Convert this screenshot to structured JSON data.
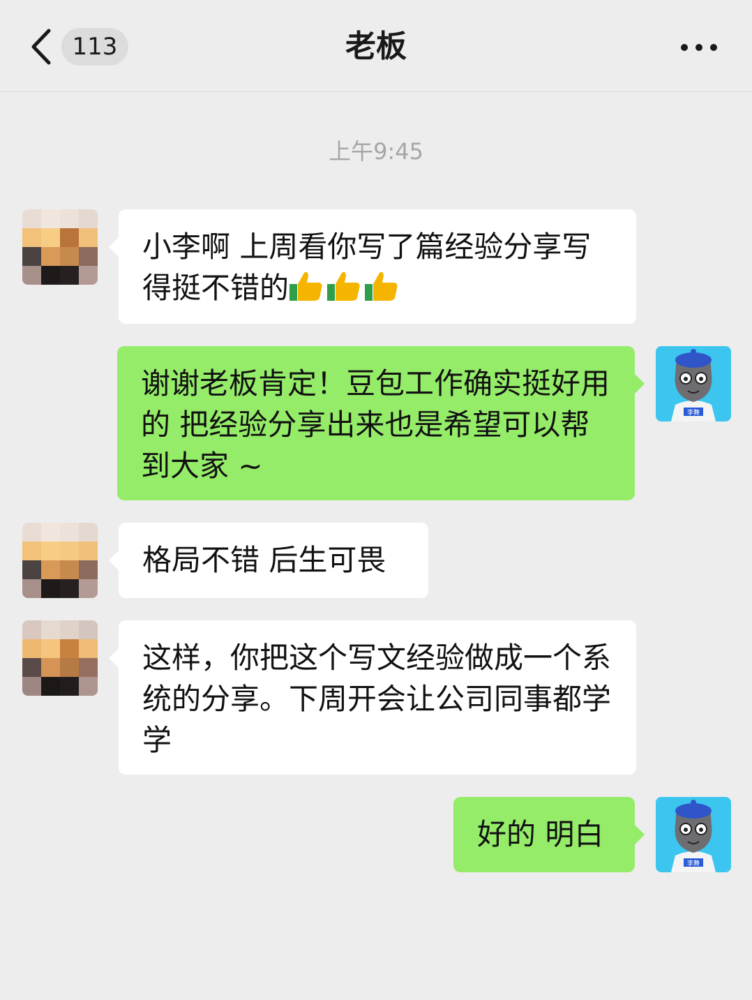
{
  "header": {
    "unread_count": "113",
    "title": "老板"
  },
  "chat": {
    "timestamp": "上午9:45",
    "messages": [
      {
        "sender": "boss",
        "text": "小李啊 上周看你写了篇经验分享写得挺不错的",
        "emoji": [
          "thumbs-up",
          "thumbs-up",
          "thumbs-up"
        ]
      },
      {
        "sender": "me",
        "text": "谢谢老板肯定！豆包工作确实挺好用的 把经验分享出来也是希望可以帮到大家 ~"
      },
      {
        "sender": "boss",
        "text": "格局不错 后生可畏"
      },
      {
        "sender": "boss",
        "text": "这样，你把这个写文经验做成一个系统的分享。下周开会让公司同事都学学"
      },
      {
        "sender": "me",
        "text": "好的 明白"
      }
    ]
  },
  "avatar_badge_text": "李舞",
  "colors": {
    "background": "#ededed",
    "incoming_bubble": "#ffffff",
    "outgoing_bubble": "#95ec69"
  }
}
